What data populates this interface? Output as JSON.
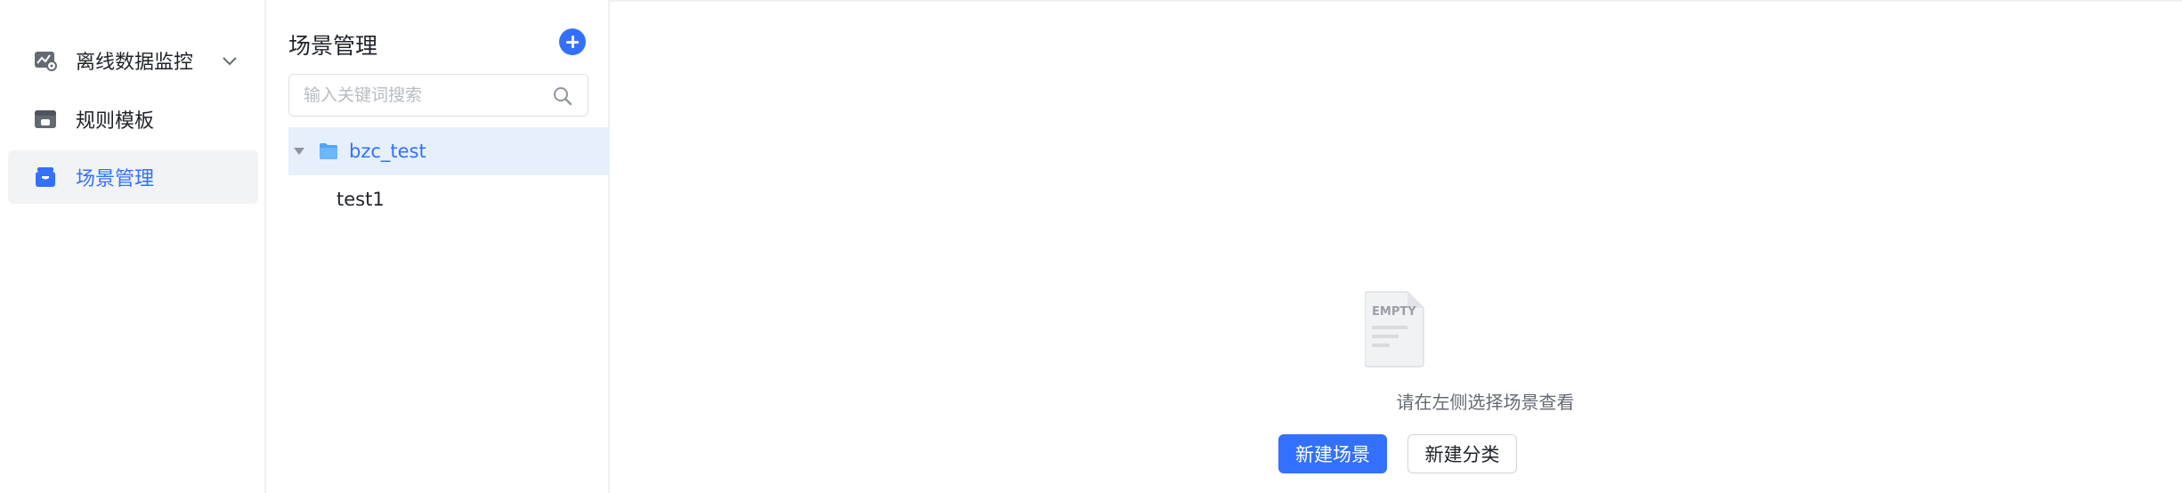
{
  "nav": {
    "items": [
      {
        "label": "离线数据监控",
        "icon": "monitor-chart-icon",
        "expandable": true,
        "active": false
      },
      {
        "label": "规则模板",
        "icon": "template-icon",
        "expandable": false,
        "active": false
      },
      {
        "label": "场景管理",
        "icon": "scene-box-icon",
        "expandable": false,
        "active": true
      }
    ]
  },
  "tree": {
    "title": "场景管理",
    "search_placeholder": "输入关键词搜索",
    "search_value": "",
    "nodes": [
      {
        "label": "bzc_test",
        "type": "folder",
        "expanded": true,
        "selected": true
      },
      {
        "label": "test1",
        "type": "leaf"
      }
    ]
  },
  "empty": {
    "image_text": "EMPTY",
    "message": "请在左侧选择场景查看",
    "primary_button": "新建场景",
    "secondary_button": "新建分类"
  },
  "colors": {
    "accent": "#3370ff",
    "selected_bg": "#e6f0fc",
    "active_nav_bg": "#f2f3f5"
  }
}
